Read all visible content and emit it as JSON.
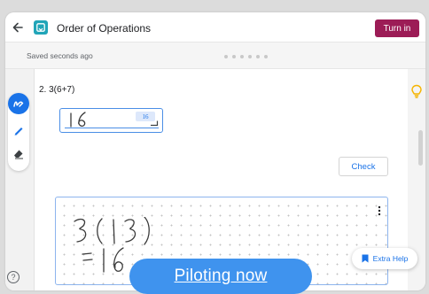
{
  "header": {
    "title": "Order of Operations",
    "turn_in_label": "Turn in",
    "turn_in_color": "#9c1c56",
    "icons": [
      "arrow-left-icon",
      "app-logo-icon"
    ]
  },
  "status": {
    "saved_text": "Saved seconds ago",
    "progress_dots": 6
  },
  "toolbar": {
    "tools": [
      "draw-mode-icon",
      "pen-icon",
      "eraser-icon"
    ],
    "active_tool": "draw-mode-icon",
    "help_icon": "question-circle-icon",
    "accent_color": "#1a73e8"
  },
  "question": {
    "label": "2. 3(6+7)",
    "answer_handwritten": "16",
    "answer_recognized": "16",
    "check_label": "Check"
  },
  "work_area": {
    "handwritten_lines": [
      "3(13)",
      "=16"
    ],
    "menu_icon": "more-vert-icon"
  },
  "side": {
    "hint_icon": "lightbulb-icon",
    "hint_color": "#f5b400"
  },
  "extra_help": {
    "label": "Extra Help",
    "icon": "bookmark-icon"
  },
  "banner": {
    "text": "Piloting now",
    "color": "#3f93ee"
  }
}
